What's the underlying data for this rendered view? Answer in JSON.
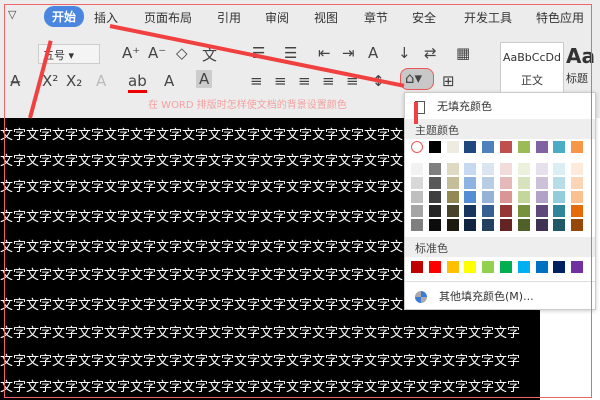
{
  "tabs": [
    "开始",
    "插入",
    "页面布局",
    "引用",
    "审阅",
    "视图",
    "章节",
    "安全",
    "开发工具",
    "特色应用"
  ],
  "ribbon": {
    "font_size": "五号",
    "style_normal_preview": "AaBbCcDd",
    "style_normal": "正文",
    "style_heading_preview": "Aa",
    "style_heading": "标题"
  },
  "caption": "在 WORD 排版时怎样使文档的背景设置颜色",
  "doc_text": "文字文字文字文字文字文字文字文字文字文字文字文字文字文字文字文字文字文字文字文字",
  "menu": {
    "no_fill": "无填充颜色",
    "theme_colors_label": "主题颜色",
    "theme_top": [
      "#ffffff",
      "#000000",
      "#eeece1",
      "#1f497d",
      "#4f81bd",
      "#c0504d",
      "#9bbb59",
      "#8064a2",
      "#4bacc6",
      "#f79646"
    ],
    "theme_shades": [
      [
        "#f2f2f2",
        "#7f7f7f",
        "#ddd9c3",
        "#c6d9f0",
        "#dbe5f1",
        "#f2dcdb",
        "#ebf1dd",
        "#e5e0ec",
        "#dbeef3",
        "#fdeada"
      ],
      [
        "#d8d8d8",
        "#595959",
        "#c4bd97",
        "#8db3e2",
        "#b8cce4",
        "#e5b9b7",
        "#d7e3bc",
        "#ccc1d9",
        "#b7dde8",
        "#fbd5b5"
      ],
      [
        "#bfbfbf",
        "#3f3f3f",
        "#938953",
        "#548dd4",
        "#95b3d7",
        "#d99694",
        "#c3d69b",
        "#b2a2c7",
        "#92cddc",
        "#fac08f"
      ],
      [
        "#a5a5a5",
        "#262626",
        "#494429",
        "#17365d",
        "#366092",
        "#953734",
        "#76923c",
        "#5f497a",
        "#31859b",
        "#e36c09"
      ],
      [
        "#7f7f7f",
        "#0c0c0c",
        "#1d1b10",
        "#0f243e",
        "#244061",
        "#632423",
        "#4f6128",
        "#3f3151",
        "#205867",
        "#974806"
      ]
    ],
    "standard_label": "标准色",
    "standard": [
      "#c00000",
      "#ff0000",
      "#ffc000",
      "#ffff00",
      "#92d050",
      "#00b050",
      "#00b0f0",
      "#0070c0",
      "#002060",
      "#7030a0"
    ],
    "more": "其他填充颜色(M)..."
  }
}
